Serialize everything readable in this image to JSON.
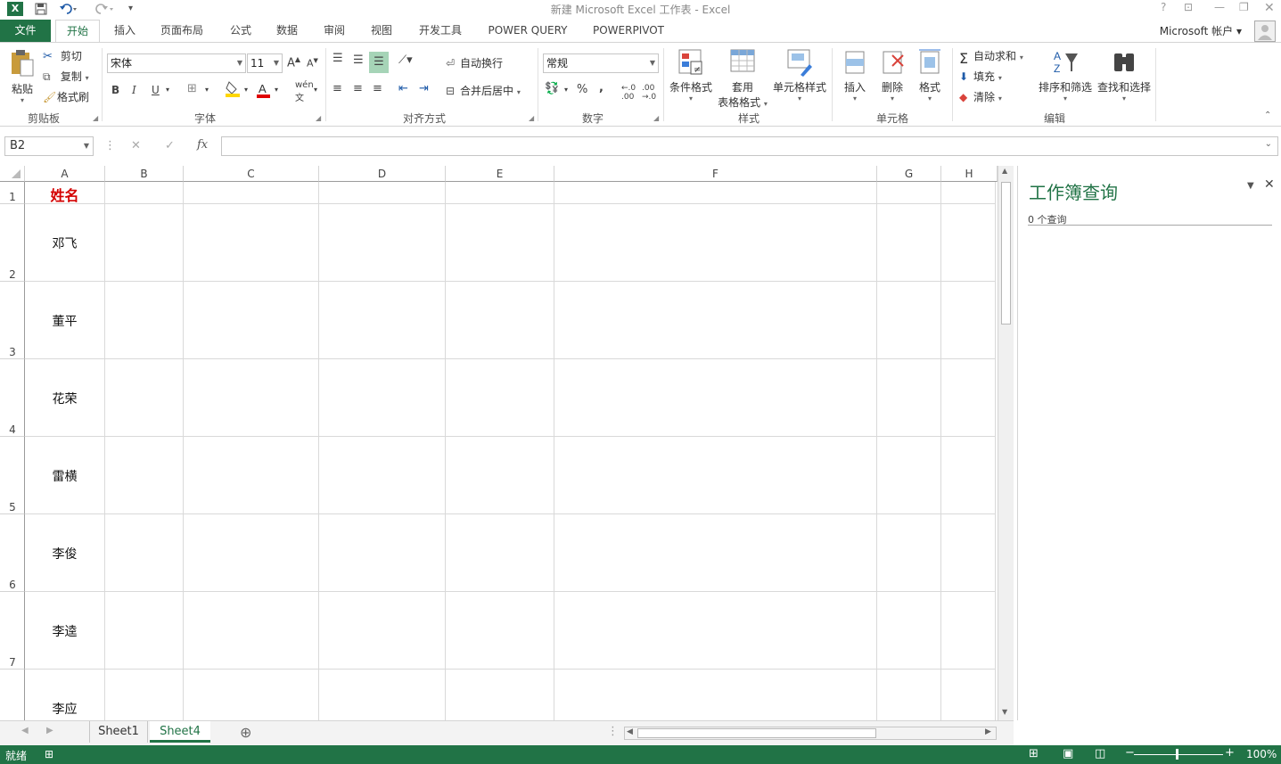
{
  "window": {
    "title": "新建 Microsoft Excel 工作表 - Excel"
  },
  "quick_access": {
    "app_icon": "excel-icon",
    "save": "save-icon",
    "undo": "undo-icon",
    "redo": "redo-icon"
  },
  "tabs": [
    {
      "label": "文件"
    },
    {
      "label": "开始"
    },
    {
      "label": "插入"
    },
    {
      "label": "页面布局"
    },
    {
      "label": "公式"
    },
    {
      "label": "数据"
    },
    {
      "label": "审阅"
    },
    {
      "label": "视图"
    },
    {
      "label": "开发工具"
    },
    {
      "label": "POWER QUERY"
    },
    {
      "label": "POWERPIVOT"
    }
  ],
  "account": {
    "label": "Microsoft 帐户"
  },
  "ribbon": {
    "clipboard": {
      "paste": "粘贴",
      "cut": "剪切",
      "copy": "复制",
      "format_painter": "格式刷",
      "group": "剪贴板"
    },
    "font": {
      "name": "宋体",
      "size": "11",
      "bold": "B",
      "italic": "I",
      "underline": "U",
      "group": "字体"
    },
    "alignment": {
      "wrap": "自动换行",
      "merge": "合并后居中",
      "group": "对齐方式"
    },
    "number": {
      "format": "常规",
      "percent": "%",
      "comma": ",",
      "group": "数字"
    },
    "styles": {
      "conditional": "条件格式",
      "table_line1": "套用",
      "table_line2": "表格格式",
      "cell_styles": "单元格样式",
      "group": "样式"
    },
    "cells": {
      "insert": "插入",
      "delete": "删除",
      "format": "格式",
      "group": "单元格"
    },
    "editing": {
      "autosum": "自动求和",
      "fill": "填充",
      "clear": "清除",
      "sort": "排序和筛选",
      "find": "查找和选择",
      "group": "编辑"
    }
  },
  "formula_bar": {
    "name_box": "B2",
    "fx": "fx",
    "value": ""
  },
  "grid": {
    "columns": [
      "A",
      "B",
      "C",
      "D",
      "E",
      "F",
      "G",
      "H"
    ],
    "rows": [
      "1",
      "2",
      "3",
      "4",
      "5",
      "6",
      "7"
    ],
    "cells": {
      "A1": "姓名",
      "A2": "邓飞",
      "A3": "董平",
      "A4": "花荣",
      "A5": "雷横",
      "A6": "李俊",
      "A7": "李逵",
      "A8": "李应"
    },
    "header_color": "#d40000"
  },
  "pane": {
    "title": "工作簿查询",
    "subtitle": "0 个查询"
  },
  "sheets": [
    {
      "label": "Sheet1"
    },
    {
      "label": "Sheet4"
    }
  ],
  "status": {
    "mode": "就绪",
    "zoom": "100%"
  },
  "colors": {
    "accent": "#217346"
  }
}
